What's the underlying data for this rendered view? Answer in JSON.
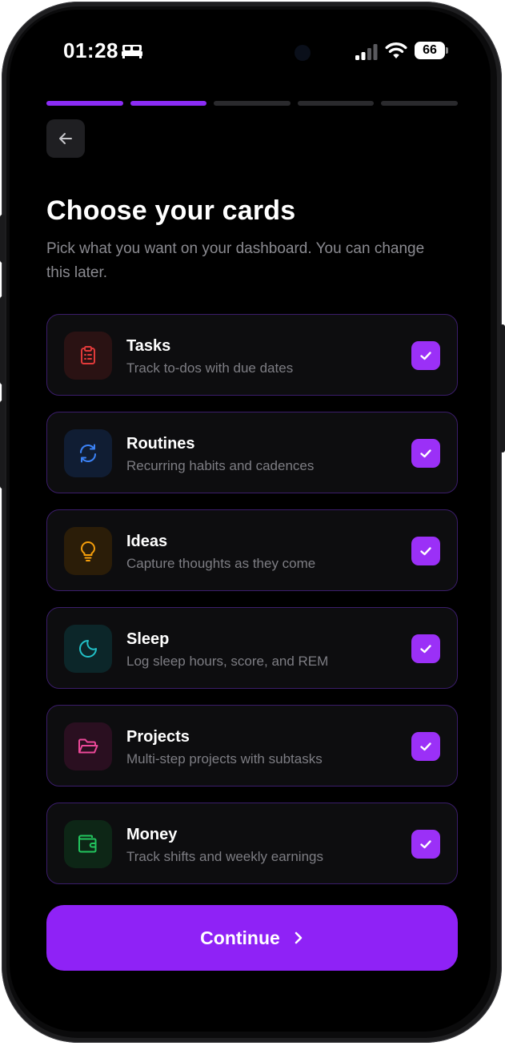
{
  "status_bar": {
    "time": "01:28",
    "battery": "66",
    "icons": [
      "bed-icon",
      "signal-icon",
      "wifi-icon",
      "battery-icon"
    ]
  },
  "progress": {
    "total_steps": 5,
    "completed_steps": 2,
    "active_color": "#8b2cf5"
  },
  "header": {
    "back_icon": "arrow-left-icon",
    "title": "Choose your cards",
    "subtitle": "Pick what you want on your dashboard. You can change this later."
  },
  "cards": [
    {
      "title": "Tasks",
      "description": "Track to-dos with due dates",
      "icon": "clipboard-icon",
      "color": "#e23a3a",
      "checked": true
    },
    {
      "title": "Routines",
      "description": "Recurring habits and cadences",
      "icon": "refresh-icon",
      "color": "#3b82f6",
      "checked": true
    },
    {
      "title": "Ideas",
      "description": "Capture thoughts as they come",
      "icon": "lightbulb-icon",
      "color": "#f59e0b",
      "checked": true
    },
    {
      "title": "Sleep",
      "description": "Log sleep hours, score, and REM",
      "icon": "moon-icon",
      "color": "#22c1c8",
      "checked": true
    },
    {
      "title": "Projects",
      "description": "Multi-step projects with subtasks",
      "icon": "folder-icon",
      "color": "#ec4899",
      "checked": true
    },
    {
      "title": "Money",
      "description": "Track shifts and weekly earnings",
      "icon": "wallet-icon",
      "color": "#22c55e",
      "checked": true
    }
  ],
  "continue_button": {
    "label": "Continue",
    "icon": "chevron-right-icon",
    "color": "#8f22f6"
  }
}
